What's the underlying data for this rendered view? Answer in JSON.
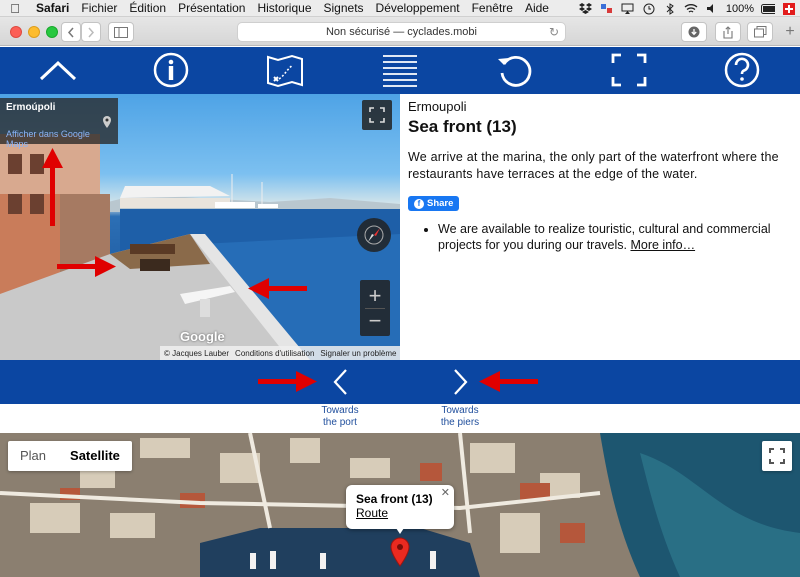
{
  "menubar": {
    "items": [
      "Safari",
      "Fichier",
      "Édition",
      "Présentation",
      "Historique",
      "Signets",
      "Développement",
      "Fenêtre",
      "Aide"
    ],
    "battery": "100%"
  },
  "browser": {
    "url_text": "Non sécurisé — cyclades.mobi"
  },
  "site_nav": {
    "icons": [
      "up-chevron-icon",
      "info-icon",
      "map-icon",
      "menu-lines-icon",
      "refresh-icon",
      "fullscreen-icon",
      "help-icon"
    ]
  },
  "street_view": {
    "place_title": "Ermoúpoli",
    "maps_link": "Afficher dans Google Maps",
    "google_logo": "Google",
    "credit": "© Jacques Lauber",
    "terms": "Conditions d'utilisation",
    "report": "Signaler un problème"
  },
  "description": {
    "place": "Ermoupoli",
    "title": "Sea front (13)",
    "text": "We arrive at the marina, the only part of the waterfront where the restaurants have terraces at the edge of the water.",
    "share_label": "Share",
    "bullet_text": "We are available to realize touristic, cultural and commercial projects for you during our travels.",
    "more_link": "More info…"
  },
  "nav_links": {
    "prev_label_1": "Towards",
    "prev_label_2": "the port",
    "next_label_1": "Towards",
    "next_label_2": "the piers"
  },
  "map": {
    "map_types": [
      "Plan",
      "Satellite"
    ],
    "selected_type": "Satellite",
    "info_title": "Sea front (13)",
    "info_link": "Route"
  },
  "colors": {
    "nav_blue": "#0b46a2",
    "annotation_red": "#e00000"
  }
}
